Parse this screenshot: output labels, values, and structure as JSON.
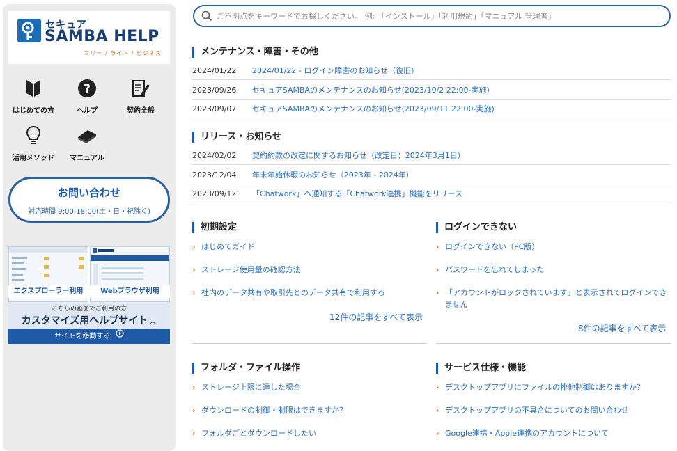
{
  "brand": {
    "kana": "セキュア",
    "title": "SAMBA HELP",
    "sub": "フリー / ライト / ビジネス"
  },
  "nav": {
    "beginner": "はじめての方",
    "help": "ヘルプ",
    "contract": "契約全般",
    "tips": "活用メソッド",
    "manual": "マニュアル"
  },
  "contact": {
    "title": "お問い合わせ",
    "hours": "対応時間 9:00-18:00(土・日・祝除く)"
  },
  "banner": {
    "left_caption": "エクスプローラー利用",
    "right_caption": "Webブラウザ利用",
    "lead": "こちらの画面でご利用の方",
    "main": "カスタマイズ用ヘルプサイト",
    "chevron": "〈",
    "go": "サイトを移動する"
  },
  "search": {
    "placeholder": "ご不明点をキーワードでお探しください。 例: 「インストール」「利用規約」「マニュアル 管理者」"
  },
  "maintenance": {
    "title": "メンテナンス・障害・その他",
    "items": [
      {
        "date": "2024/01/22",
        "text": "2024/01/22 - ログイン障害のお知らせ（復旧）"
      },
      {
        "date": "2023/09/26",
        "text": "セキュアSAMBAのメンテナンスのお知らせ(2023/10/2 22:00-実施)"
      },
      {
        "date": "2023/09/07",
        "text": "セキュアSAMBAのメンテナンスのお知らせ(2023/09/11 22:00-実施)"
      }
    ]
  },
  "release": {
    "title": "リリース・お知らせ",
    "items": [
      {
        "date": "2024/02/02",
        "text": "契約約款の改定に関するお知らせ（改定日：2024年3月1日）"
      },
      {
        "date": "2023/12/04",
        "text": "年末年始休暇のお知らせ（2023年 - 2024年）"
      },
      {
        "date": "2023/09/12",
        "text": "「Chatwork」へ通知する「Chatwork連携」機能をリリース"
      }
    ]
  },
  "initial": {
    "title": "初期設定",
    "items": [
      "はじめてガイド",
      "ストレージ使用量の確認方法",
      "社内のデータ共有や取引先とのデータ共有で利用する"
    ],
    "more": "12件の記事をすべて表示"
  },
  "login": {
    "title": "ログインできない",
    "items": [
      "ログインできない（PC版）",
      "パスワードを忘れてしまった",
      "「アカウントがロックされています」と表示されてログインできません"
    ],
    "more": "8件の記事をすべて表示"
  },
  "folder": {
    "title": "フォルダ・ファイル操作",
    "items": [
      "ストレージ上限に達した場合",
      "ダウンロードの制御・制限はできますか？",
      "フォルダごとダウンロードしたい"
    ]
  },
  "service": {
    "title": "サービス仕様・機能",
    "items": [
      "デスクトップアプリにファイルの排他制御はありますか？",
      "デスクトップアプリの不具合についてのお問い合わせ",
      "Google連携・Apple連携のアカウントについて"
    ]
  }
}
